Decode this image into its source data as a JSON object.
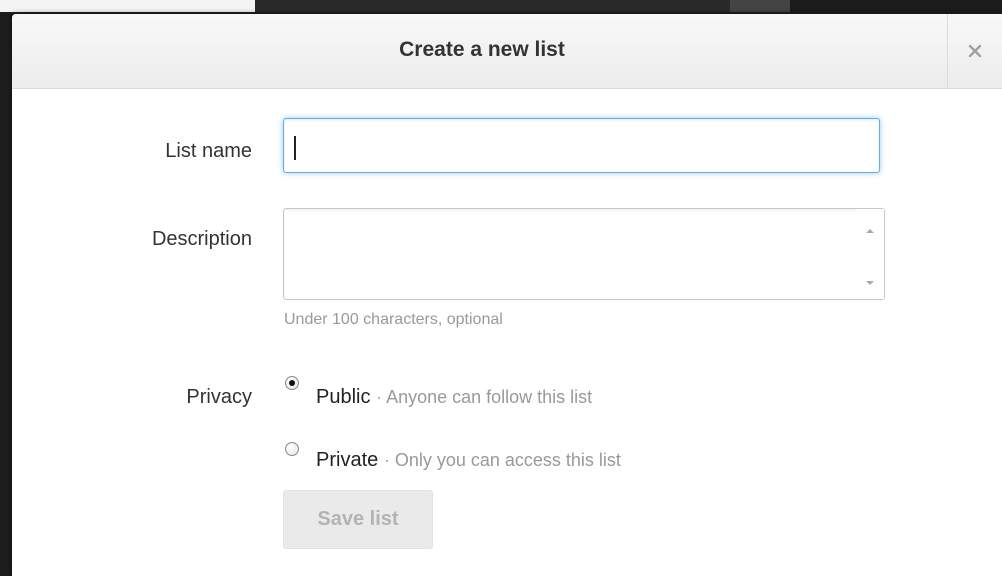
{
  "dialog": {
    "title": "Create a new list",
    "close_icon": "close-icon"
  },
  "form": {
    "name_label": "List name",
    "name_value": "",
    "description_label": "Description",
    "description_value": "",
    "description_hint": "Under 100 characters, optional",
    "privacy_label": "Privacy",
    "privacy_options": [
      {
        "title": "Public",
        "separator": "·",
        "description": "Anyone can follow this list",
        "checked": true
      },
      {
        "title": "Private",
        "separator": "·",
        "description": "Only you can access this list",
        "checked": false
      }
    ],
    "save_label": "Save list",
    "save_enabled": false
  },
  "colors": {
    "focus_border": "#64aee6",
    "hint_text": "#999999",
    "disabled_button_bg": "#eaeaea"
  }
}
